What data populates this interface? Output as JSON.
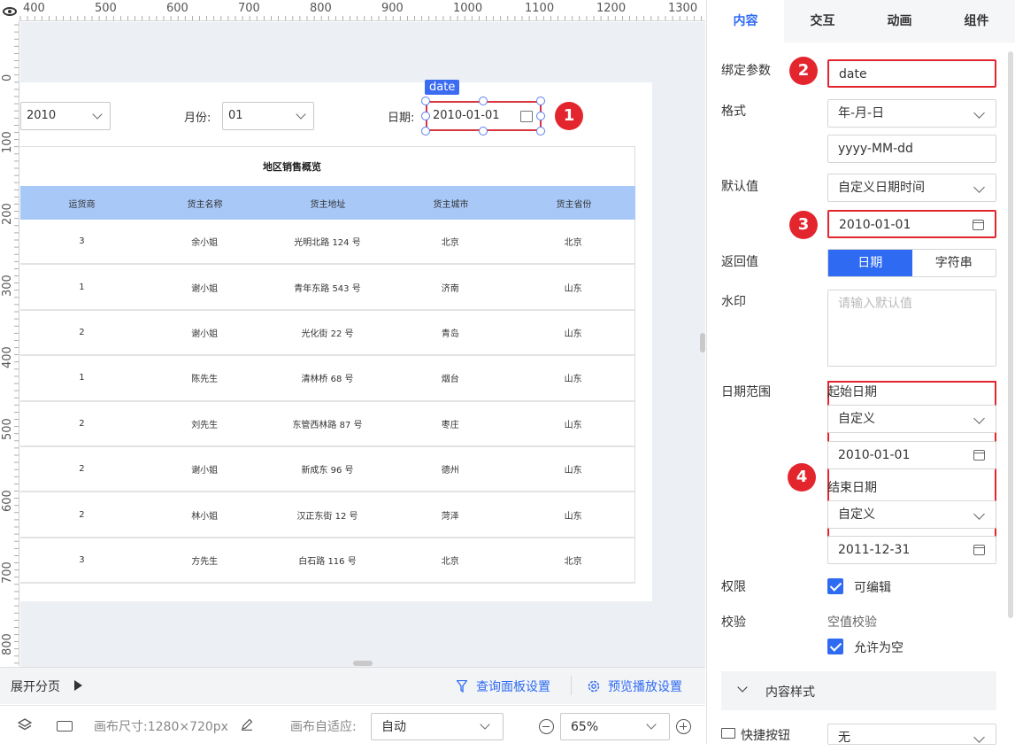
{
  "ruler": {
    "top_ticks": [
      "400",
      "500",
      "600",
      "700",
      "800",
      "900",
      "1000",
      "1100",
      "1200",
      "1300"
    ],
    "left_ticks": [
      "0",
      "100",
      "200",
      "300",
      "400",
      "500",
      "600",
      "700",
      "800"
    ]
  },
  "query": {
    "year_value": "2010",
    "month_label": "月份:",
    "month_value": "01",
    "date_label": "日期:",
    "date_value": "2010-01-01",
    "date_tag": "date"
  },
  "badges": [
    "1",
    "2",
    "3",
    "4"
  ],
  "table": {
    "title": "地区销售概览",
    "columns": [
      "运货商",
      "货主名称",
      "货主地址",
      "货主城市",
      "货主省份"
    ],
    "rows": [
      [
        "3",
        "余小姐",
        "光明北路 124 号",
        "北京",
        "北京"
      ],
      [
        "1",
        "谢小姐",
        "青年东路 543 号",
        "济南",
        "山东"
      ],
      [
        "2",
        "谢小姐",
        "光化街 22 号",
        "青岛",
        "山东"
      ],
      [
        "1",
        "陈先生",
        "清林桥 68 号",
        "烟台",
        "山东"
      ],
      [
        "2",
        "刘先生",
        "东管西林路 87 号",
        "枣庄",
        "山东"
      ],
      [
        "2",
        "谢小姐",
        "新成东 96 号",
        "德州",
        "山东"
      ],
      [
        "2",
        "林小姐",
        "汉正东街 12 号",
        "菏泽",
        "山东"
      ],
      [
        "3",
        "方先生",
        "白石路 116 号",
        "北京",
        "北京"
      ]
    ]
  },
  "bottom": {
    "expand_pages": "展开分页",
    "query_panel_settings": "查询面板设置",
    "preview_settings": "预览播放设置",
    "canvas_size": "画布尺寸:1280×720px",
    "canvas_fit_label": "画布自适应:",
    "canvas_fit_value": "自动",
    "zoom": "65%"
  },
  "panel": {
    "tabs": [
      "内容",
      "交互",
      "动画",
      "组件"
    ],
    "bind_param_label": "绑定参数",
    "bind_param_value": "date",
    "format_label": "格式",
    "format_value": "年-月-日",
    "format_pattern": "yyyy-MM-dd",
    "default_label": "默认值",
    "default_type": "自定义日期时间",
    "default_value": "2010-01-01",
    "return_label": "返回值",
    "return_opt_date": "日期",
    "return_opt_string": "字符串",
    "watermark_label": "水印",
    "watermark_placeholder": "请输入默认值",
    "range_label": "日期范围",
    "start_label": "起始日期",
    "start_type": "自定义",
    "start_value": "2010-01-01",
    "end_label": "结束日期",
    "end_type": "自定义",
    "end_value": "2011-12-31",
    "permission_label": "权限",
    "editable_label": "可编辑",
    "validation_label": "校验",
    "null_check_label": "空值校验",
    "allow_null_label": "允许为空",
    "content_style_label": "内容样式",
    "shortcut_label": "快捷按钮",
    "shortcut_value": "无"
  },
  "colors": {
    "accent": "#2f6bf2",
    "highlight": "#e3262e",
    "table_header": "#a8c8f8"
  }
}
